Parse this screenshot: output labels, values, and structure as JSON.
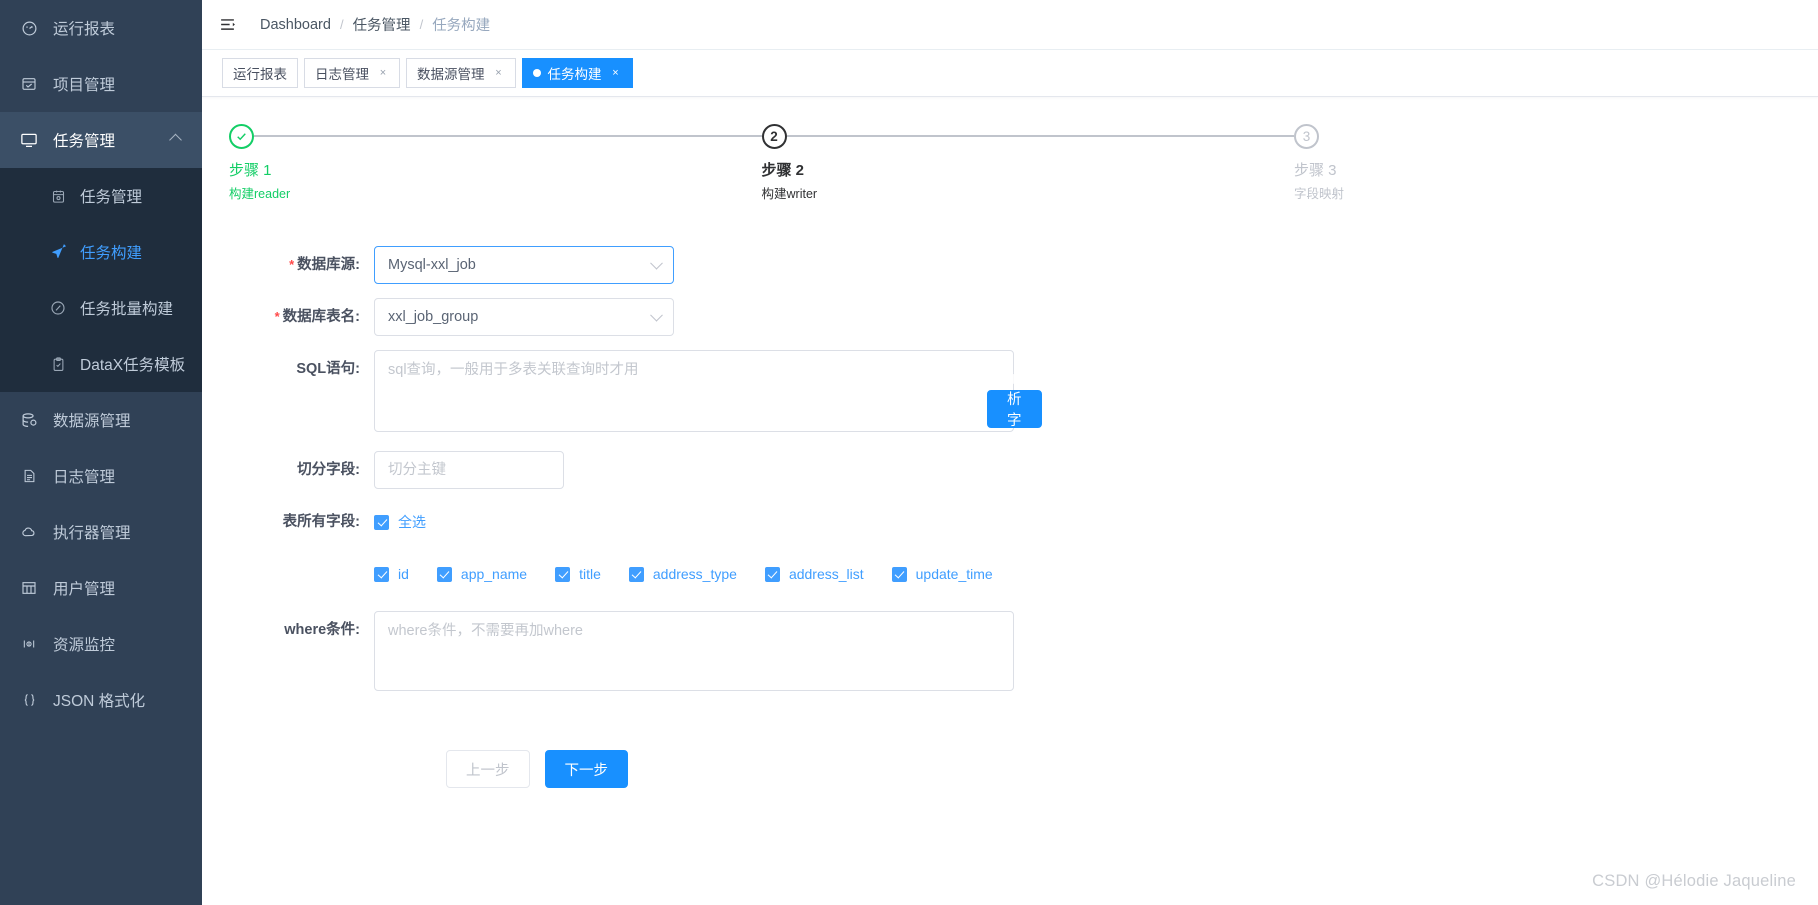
{
  "sidebar": {
    "items": [
      {
        "label": "运行报表",
        "icon": "dashboard-icon",
        "type": "item"
      },
      {
        "label": "项目管理",
        "icon": "project-icon",
        "type": "item"
      },
      {
        "label": "任务管理",
        "icon": "monitor-icon",
        "type": "parent",
        "expanded": true,
        "children": [
          {
            "label": "任务管理",
            "icon": "calendar-icon",
            "selected": false
          },
          {
            "label": "任务构建",
            "icon": "send-icon",
            "selected": true
          },
          {
            "label": "任务批量构建",
            "icon": "batch-icon",
            "selected": false
          },
          {
            "label": "DataX任务模板",
            "icon": "template-icon",
            "selected": false
          }
        ]
      },
      {
        "label": "数据源管理",
        "icon": "database-icon",
        "type": "item"
      },
      {
        "label": "日志管理",
        "icon": "document-icon",
        "type": "item"
      },
      {
        "label": "执行器管理",
        "icon": "cloud-icon",
        "type": "item"
      },
      {
        "label": "用户管理",
        "icon": "grid-icon",
        "type": "item"
      },
      {
        "label": "资源监控",
        "icon": "monitor-resource-icon",
        "type": "item"
      },
      {
        "label": "JSON 格式化",
        "icon": "braces-icon",
        "type": "item"
      }
    ]
  },
  "navbar": {
    "hamburger_icon": "hamburger-icon",
    "breadcrumb": [
      {
        "label": "Dashboard",
        "state": "link"
      },
      {
        "label": "任务管理",
        "state": "link"
      },
      {
        "label": "任务构建",
        "state": "current"
      }
    ],
    "separator": "/"
  },
  "tags": [
    {
      "label": "运行报表",
      "active": false,
      "closable": false
    },
    {
      "label": "日志管理",
      "active": false,
      "closable": true
    },
    {
      "label": "数据源管理",
      "active": false,
      "closable": true
    },
    {
      "label": "任务构建",
      "active": true,
      "closable": true
    }
  ],
  "close_glyph": "×",
  "steps": [
    {
      "title": "步骤 1",
      "desc": "构建reader",
      "status": "finish",
      "marker": "✓"
    },
    {
      "title": "步骤 2",
      "desc": "构建writer",
      "status": "process",
      "marker": "2"
    },
    {
      "title": "步骤 3",
      "desc": "字段映射",
      "status": "wait",
      "marker": "3"
    }
  ],
  "form": {
    "datasource": {
      "label": "数据库源:",
      "required": true,
      "value": "Mysql-xxl_job",
      "focused": true
    },
    "table": {
      "label": "数据库表名:",
      "required": true,
      "value": "xxl_job_group",
      "focused": false
    },
    "sql": {
      "label": "SQL语句:",
      "placeholder": "sql查询，一般用于多表关联查询时才用",
      "value": ""
    },
    "parse_button": {
      "label": "解析字段"
    },
    "split": {
      "label": "切分字段:",
      "placeholder": "切分主键",
      "value": ""
    },
    "all_fields": {
      "label": "表所有字段:",
      "select_all_label": "全选",
      "select_all_checked": true,
      "fields": [
        {
          "name": "id",
          "checked": true
        },
        {
          "name": "app_name",
          "checked": true
        },
        {
          "name": "title",
          "checked": true
        },
        {
          "name": "address_type",
          "checked": true
        },
        {
          "name": "address_list",
          "checked": true
        },
        {
          "name": "update_time",
          "checked": true
        }
      ]
    },
    "where": {
      "label": "where条件:",
      "placeholder": "where条件，不需要再加where",
      "value": ""
    }
  },
  "footer": {
    "prev_label": "上一步",
    "next_label": "下一步"
  },
  "watermark": "CSDN @Hélodie Jaqueline",
  "colors": {
    "primary": "#1890ff",
    "link": "#409eff",
    "success": "#13ce66",
    "sidebar_bg": "#304156",
    "subnav_bg": "#1f2d3d",
    "required": "#ff4949"
  }
}
